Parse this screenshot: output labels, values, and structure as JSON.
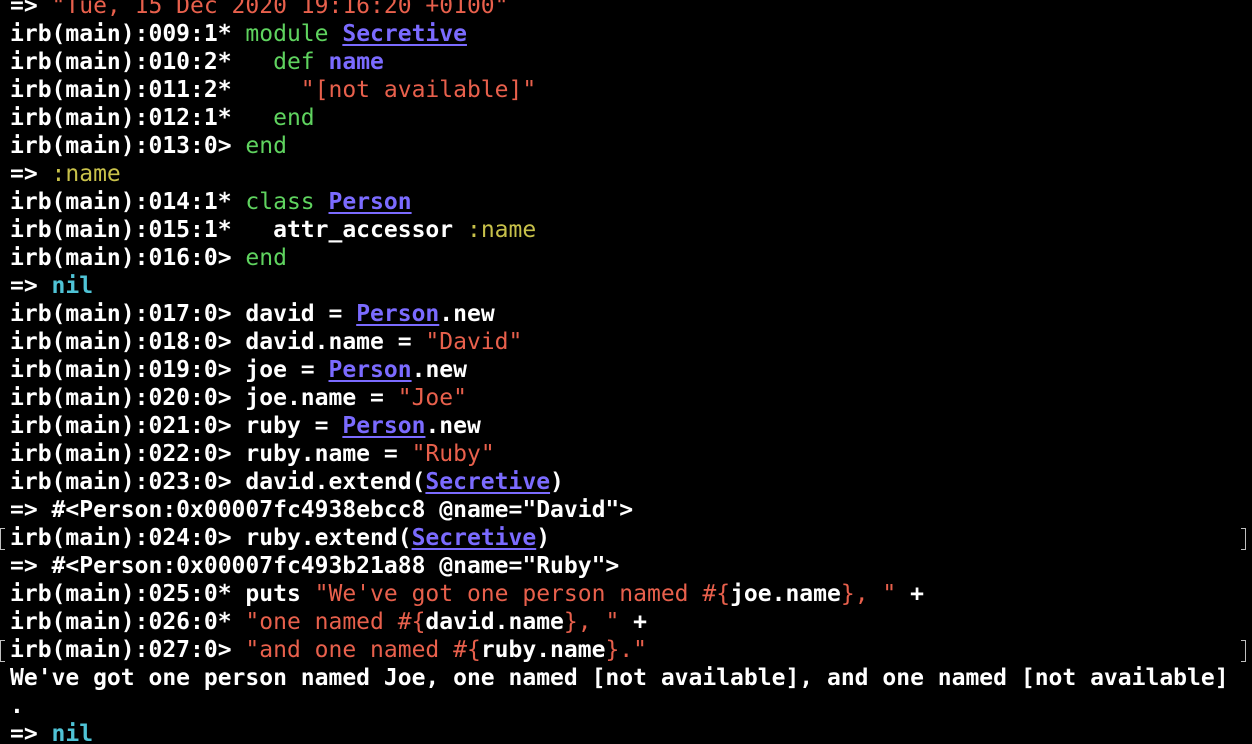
{
  "terminal": {
    "background": "#000000",
    "colors": {
      "prompt": "#ffffff",
      "keyword": "#5fd35f",
      "constant": "#7b6bff",
      "string": "#e8604c",
      "symbol": "#c8c14a",
      "nil": "#4fc3d6"
    },
    "lines": [
      {
        "segments": [
          {
            "text": "=> ",
            "style": "white"
          },
          {
            "text": "\"Tue, 15 Dec 2020 19:16:20 +0100\"",
            "style": "red"
          }
        ]
      },
      {
        "segments": [
          {
            "text": "irb(main):009:1* ",
            "style": "white"
          },
          {
            "text": "module ",
            "style": "green"
          },
          {
            "text": "Secretive",
            "style": "purple"
          }
        ]
      },
      {
        "segments": [
          {
            "text": "irb(main):010:2*   ",
            "style": "white"
          },
          {
            "text": "def ",
            "style": "green"
          },
          {
            "text": "name",
            "style": "purple-plain"
          }
        ]
      },
      {
        "segments": [
          {
            "text": "irb(main):011:2*     ",
            "style": "white"
          },
          {
            "text": "\"[not available]\"",
            "style": "red"
          }
        ]
      },
      {
        "segments": [
          {
            "text": "irb(main):012:1*   ",
            "style": "white"
          },
          {
            "text": "end",
            "style": "green"
          }
        ]
      },
      {
        "segments": [
          {
            "text": "irb(main):013:0> ",
            "style": "white"
          },
          {
            "text": "end",
            "style": "green"
          }
        ]
      },
      {
        "segments": [
          {
            "text": "=> ",
            "style": "white"
          },
          {
            "text": ":name",
            "style": "yellow"
          }
        ]
      },
      {
        "segments": [
          {
            "text": "irb(main):014:1* ",
            "style": "white"
          },
          {
            "text": "class ",
            "style": "green"
          },
          {
            "text": "Person",
            "style": "purple"
          }
        ]
      },
      {
        "segments": [
          {
            "text": "irb(main):015:1*   attr_accessor ",
            "style": "white"
          },
          {
            "text": ":name",
            "style": "yellow"
          }
        ]
      },
      {
        "segments": [
          {
            "text": "irb(main):016:0> ",
            "style": "white"
          },
          {
            "text": "end",
            "style": "green"
          }
        ]
      },
      {
        "segments": [
          {
            "text": "=> ",
            "style": "white"
          },
          {
            "text": "nil",
            "style": "cyan"
          }
        ]
      },
      {
        "segments": [
          {
            "text": "irb(main):017:0> david = ",
            "style": "white"
          },
          {
            "text": "Person",
            "style": "purple"
          },
          {
            "text": ".new",
            "style": "white"
          }
        ]
      },
      {
        "segments": [
          {
            "text": "irb(main):018:0> david.name = ",
            "style": "white"
          },
          {
            "text": "\"David\"",
            "style": "red"
          }
        ]
      },
      {
        "segments": [
          {
            "text": "irb(main):019:0> joe = ",
            "style": "white"
          },
          {
            "text": "Person",
            "style": "purple"
          },
          {
            "text": ".new",
            "style": "white"
          }
        ]
      },
      {
        "segments": [
          {
            "text": "irb(main):020:0> joe.name = ",
            "style": "white"
          },
          {
            "text": "\"Joe\"",
            "style": "red"
          }
        ]
      },
      {
        "segments": [
          {
            "text": "irb(main):021:0> ruby = ",
            "style": "white"
          },
          {
            "text": "Person",
            "style": "purple"
          },
          {
            "text": ".new",
            "style": "white"
          }
        ]
      },
      {
        "segments": [
          {
            "text": "irb(main):022:0> ruby.name = ",
            "style": "white"
          },
          {
            "text": "\"Ruby\"",
            "style": "red"
          }
        ]
      },
      {
        "segments": [
          {
            "text": "irb(main):023:0> david.extend(",
            "style": "white"
          },
          {
            "text": "Secretive",
            "style": "purple"
          },
          {
            "text": ")",
            "style": "white"
          }
        ]
      },
      {
        "segments": [
          {
            "text": "=> #<Person:0x00007fc4938ebcc8 @name=\"David\">",
            "style": "white"
          }
        ]
      },
      {
        "marked": true,
        "segments": [
          {
            "text": "irb(main):024:0> ruby.extend(",
            "style": "white"
          },
          {
            "text": "Secretive",
            "style": "purple"
          },
          {
            "text": ")",
            "style": "white"
          }
        ]
      },
      {
        "segments": [
          {
            "text": "=> #<Person:0x00007fc493b21a88 @name=\"Ruby\">",
            "style": "white"
          }
        ]
      },
      {
        "segments": [
          {
            "text": "irb(main):025:0* puts ",
            "style": "white"
          },
          {
            "text": "\"We've got one person named #{",
            "style": "red"
          },
          {
            "text": "joe.name",
            "style": "white"
          },
          {
            "text": "}, \"",
            "style": "red"
          },
          {
            "text": " +",
            "style": "white"
          }
        ]
      },
      {
        "segments": [
          {
            "text": "irb(main):026:0* ",
            "style": "white"
          },
          {
            "text": "\"one named #{",
            "style": "red"
          },
          {
            "text": "david.name",
            "style": "white"
          },
          {
            "text": "}, \"",
            "style": "red"
          },
          {
            "text": " +",
            "style": "white"
          }
        ]
      },
      {
        "marked": true,
        "segments": [
          {
            "text": "irb(main):027:0> ",
            "style": "white"
          },
          {
            "text": "\"and one named #{",
            "style": "red"
          },
          {
            "text": "ruby.name",
            "style": "white"
          },
          {
            "text": "}.\"",
            "style": "red"
          }
        ]
      },
      {
        "segments": [
          {
            "text": "We've got one person named Joe, one named [not available], and one named [not available]",
            "style": "white"
          }
        ]
      },
      {
        "segments": [
          {
            "text": ".",
            "style": "white"
          }
        ]
      },
      {
        "segments": [
          {
            "text": "=> ",
            "style": "white"
          },
          {
            "text": "nil",
            "style": "cyan"
          }
        ]
      }
    ]
  }
}
